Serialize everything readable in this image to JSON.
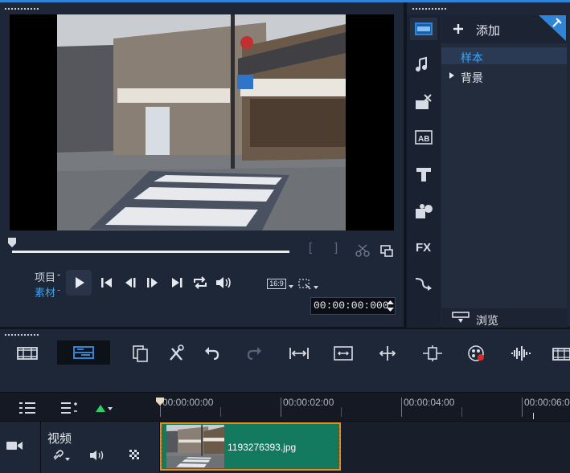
{
  "player": {
    "mode_project": "项目",
    "mode_clip": "素材",
    "mode_dash": "-",
    "aspect_ratio": "16:9",
    "timecode": "00:00:00:000",
    "mark_in": "[",
    "mark_out": "]"
  },
  "library": {
    "add_label": "添加",
    "items": [
      {
        "label": "样本"
      },
      {
        "label": "背景"
      }
    ],
    "browse_label": "浏览"
  },
  "timeline": {
    "ruler": [
      "00:00:00:00",
      "00:00:02:00",
      "00:00:04:00",
      "00:00:06:0"
    ],
    "track_label": "视频",
    "clip_name": "1193276393.jpg"
  },
  "colors": {
    "accent": "#2f84d8",
    "clip_fill": "#137a60",
    "clip_border": "#e88f1a",
    "clip_text_active": "#3ea3f2"
  }
}
